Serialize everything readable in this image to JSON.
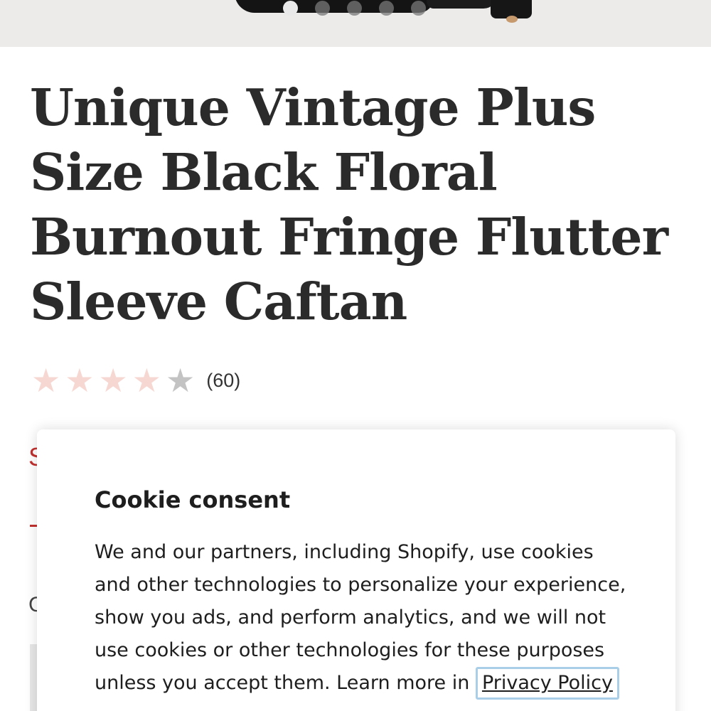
{
  "gallery": {
    "slide_count": 5,
    "active_slide": 1
  },
  "product": {
    "title": "Unique Vintage Plus Size Black Floral Burnout Fringe Flutter Sleeve Caftan",
    "rating_value": 4,
    "rating_max": 5,
    "review_count": "(60)",
    "price_partial": "S",
    "option_partial": "C"
  },
  "cookie_consent": {
    "title": "Cookie consent",
    "body": "We and our partners, including Shopify, use cookies and other technologies to personalize your experience, show you ads, and perform analytics, and we will not use cookies or other technologies for these purposes unless you accept them. Learn more in",
    "link_label": "Privacy Policy"
  },
  "colors": {
    "title": "#2b2b2b",
    "sale_red": "#c0312f",
    "star_filled": "#f7d7d2",
    "star_empty": "#c3c3c3",
    "link_focus": "#a9cfe8"
  }
}
